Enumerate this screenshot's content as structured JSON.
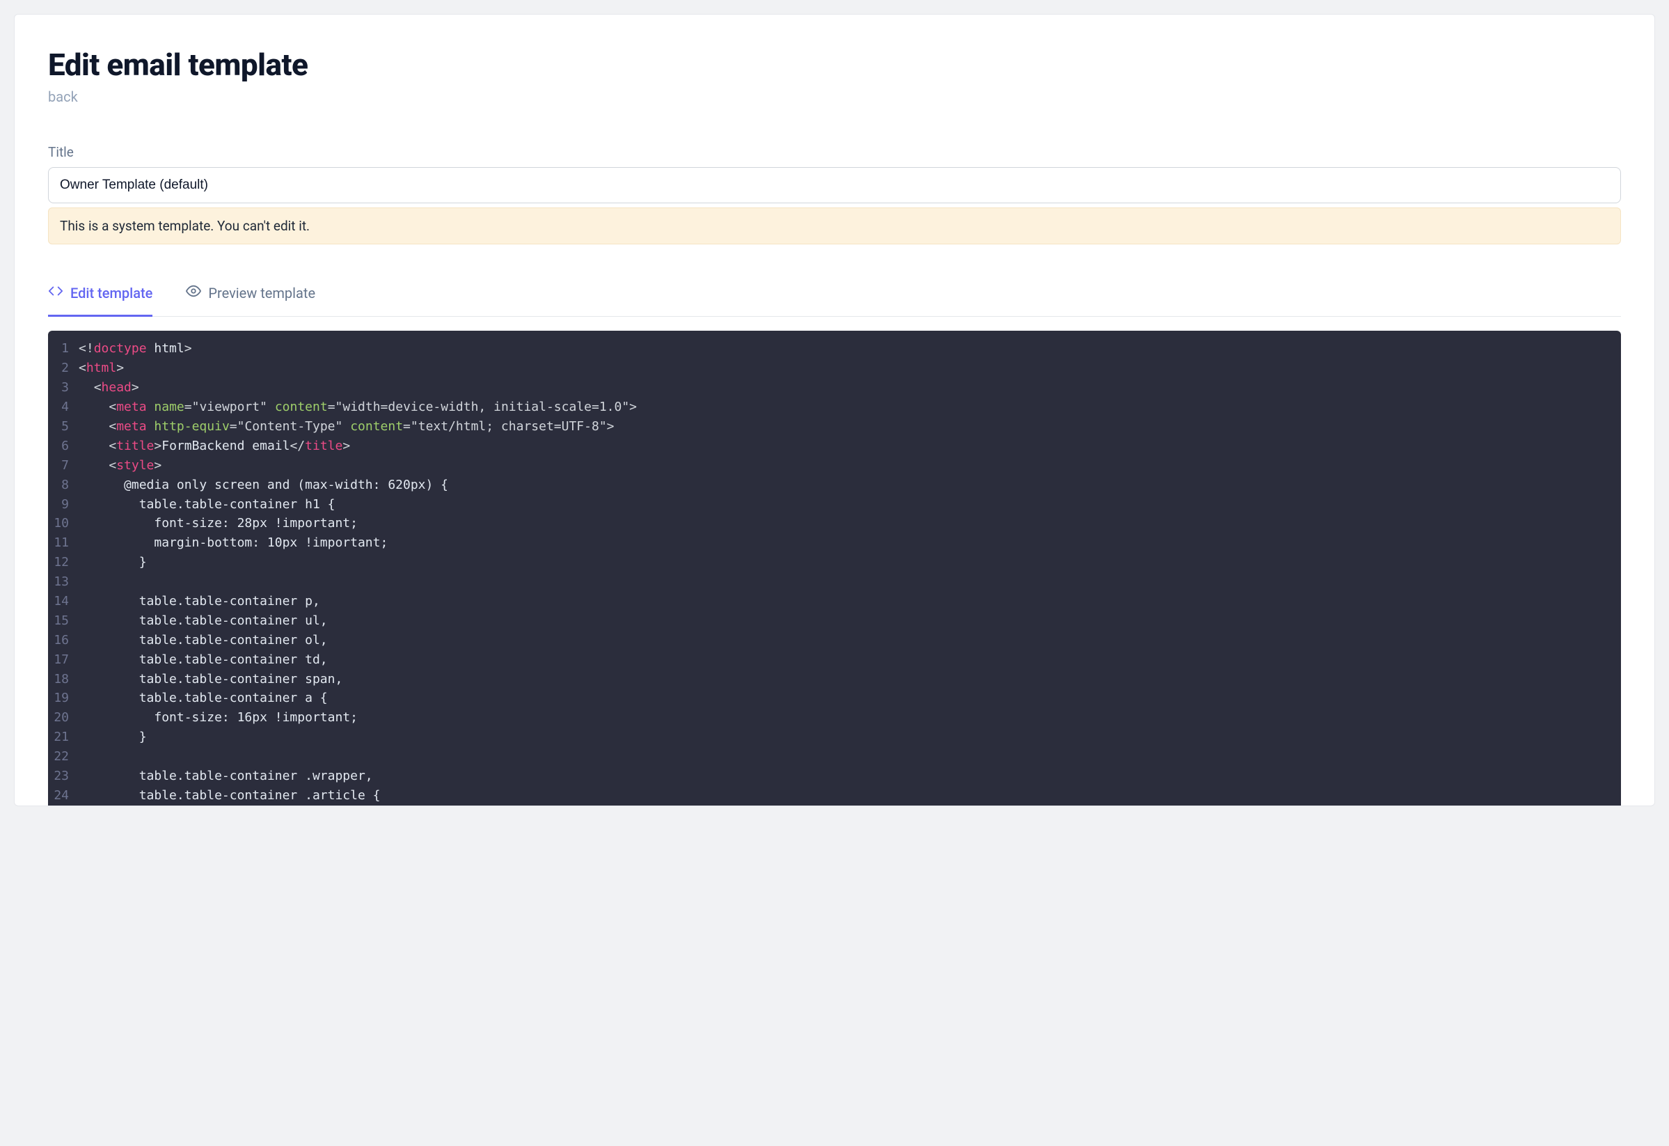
{
  "header": {
    "title": "Edit email template",
    "back_label": "back"
  },
  "form": {
    "title_label": "Title",
    "title_value": "Owner Template (default)",
    "notice": "This is a system template. You can't edit it."
  },
  "tabs": {
    "edit_label": "Edit template",
    "preview_label": "Preview template"
  },
  "code_lines": [
    {
      "n": 1,
      "segments": [
        {
          "c": "t-punc",
          "t": "<!"
        },
        {
          "c": "t-tag",
          "t": "doctype"
        },
        {
          "c": "t-text",
          "t": " html"
        },
        {
          "c": "t-punc",
          "t": ">"
        }
      ]
    },
    {
      "n": 2,
      "segments": [
        {
          "c": "t-punc",
          "t": "<"
        },
        {
          "c": "t-tag",
          "t": "html"
        },
        {
          "c": "t-punc",
          "t": ">"
        }
      ]
    },
    {
      "n": 3,
      "segments": [
        {
          "c": "t-text",
          "t": "  "
        },
        {
          "c": "t-punc",
          "t": "<"
        },
        {
          "c": "t-tag",
          "t": "head"
        },
        {
          "c": "t-punc",
          "t": ">"
        }
      ]
    },
    {
      "n": 4,
      "segments": [
        {
          "c": "t-text",
          "t": "    "
        },
        {
          "c": "t-punc",
          "t": "<"
        },
        {
          "c": "t-tag",
          "t": "meta"
        },
        {
          "c": "t-text",
          "t": " "
        },
        {
          "c": "t-attr",
          "t": "name"
        },
        {
          "c": "t-punc",
          "t": "="
        },
        {
          "c": "t-str",
          "t": "\"viewport\""
        },
        {
          "c": "t-text",
          "t": " "
        },
        {
          "c": "t-attr",
          "t": "content"
        },
        {
          "c": "t-punc",
          "t": "="
        },
        {
          "c": "t-str",
          "t": "\"width=device-width, initial-scale=1.0\""
        },
        {
          "c": "t-punc",
          "t": ">"
        }
      ]
    },
    {
      "n": 5,
      "segments": [
        {
          "c": "t-text",
          "t": "    "
        },
        {
          "c": "t-punc",
          "t": "<"
        },
        {
          "c": "t-tag",
          "t": "meta"
        },
        {
          "c": "t-text",
          "t": " "
        },
        {
          "c": "t-attr",
          "t": "http-equiv"
        },
        {
          "c": "t-punc",
          "t": "="
        },
        {
          "c": "t-str",
          "t": "\"Content-Type\""
        },
        {
          "c": "t-text",
          "t": " "
        },
        {
          "c": "t-attr",
          "t": "content"
        },
        {
          "c": "t-punc",
          "t": "="
        },
        {
          "c": "t-str",
          "t": "\"text/html; charset=UTF-8\""
        },
        {
          "c": "t-punc",
          "t": ">"
        }
      ]
    },
    {
      "n": 6,
      "segments": [
        {
          "c": "t-text",
          "t": "    "
        },
        {
          "c": "t-punc",
          "t": "<"
        },
        {
          "c": "t-tag",
          "t": "title"
        },
        {
          "c": "t-punc",
          "t": ">"
        },
        {
          "c": "t-text",
          "t": "FormBackend email"
        },
        {
          "c": "t-punc",
          "t": "</"
        },
        {
          "c": "t-tag",
          "t": "title"
        },
        {
          "c": "t-punc",
          "t": ">"
        }
      ]
    },
    {
      "n": 7,
      "segments": [
        {
          "c": "t-text",
          "t": "    "
        },
        {
          "c": "t-punc",
          "t": "<"
        },
        {
          "c": "t-tag",
          "t": "style"
        },
        {
          "c": "t-punc",
          "t": ">"
        }
      ]
    },
    {
      "n": 8,
      "segments": [
        {
          "c": "t-text",
          "t": "      @media only screen and (max-width: 620px) {"
        }
      ]
    },
    {
      "n": 9,
      "segments": [
        {
          "c": "t-text",
          "t": "        table.table-container h1 {"
        }
      ]
    },
    {
      "n": 10,
      "segments": [
        {
          "c": "t-text",
          "t": "          font-size: 28px !important;"
        }
      ]
    },
    {
      "n": 11,
      "segments": [
        {
          "c": "t-text",
          "t": "          margin-bottom: 10px !important;"
        }
      ]
    },
    {
      "n": 12,
      "segments": [
        {
          "c": "t-text",
          "t": "        }"
        }
      ]
    },
    {
      "n": 13,
      "segments": [
        {
          "c": "t-text",
          "t": ""
        }
      ]
    },
    {
      "n": 14,
      "segments": [
        {
          "c": "t-text",
          "t": "        table.table-container p,"
        }
      ]
    },
    {
      "n": 15,
      "segments": [
        {
          "c": "t-text",
          "t": "        table.table-container ul,"
        }
      ]
    },
    {
      "n": 16,
      "segments": [
        {
          "c": "t-text",
          "t": "        table.table-container ol,"
        }
      ]
    },
    {
      "n": 17,
      "segments": [
        {
          "c": "t-text",
          "t": "        table.table-container td,"
        }
      ]
    },
    {
      "n": 18,
      "segments": [
        {
          "c": "t-text",
          "t": "        table.table-container span,"
        }
      ]
    },
    {
      "n": 19,
      "segments": [
        {
          "c": "t-text",
          "t": "        table.table-container a {"
        }
      ]
    },
    {
      "n": 20,
      "segments": [
        {
          "c": "t-text",
          "t": "          font-size: 16px !important;"
        }
      ]
    },
    {
      "n": 21,
      "segments": [
        {
          "c": "t-text",
          "t": "        }"
        }
      ]
    },
    {
      "n": 22,
      "segments": [
        {
          "c": "t-text",
          "t": ""
        }
      ]
    },
    {
      "n": 23,
      "segments": [
        {
          "c": "t-text",
          "t": "        table.table-container .wrapper,"
        }
      ]
    },
    {
      "n": 24,
      "segments": [
        {
          "c": "t-text",
          "t": "        table.table-container .article {"
        }
      ]
    }
  ]
}
